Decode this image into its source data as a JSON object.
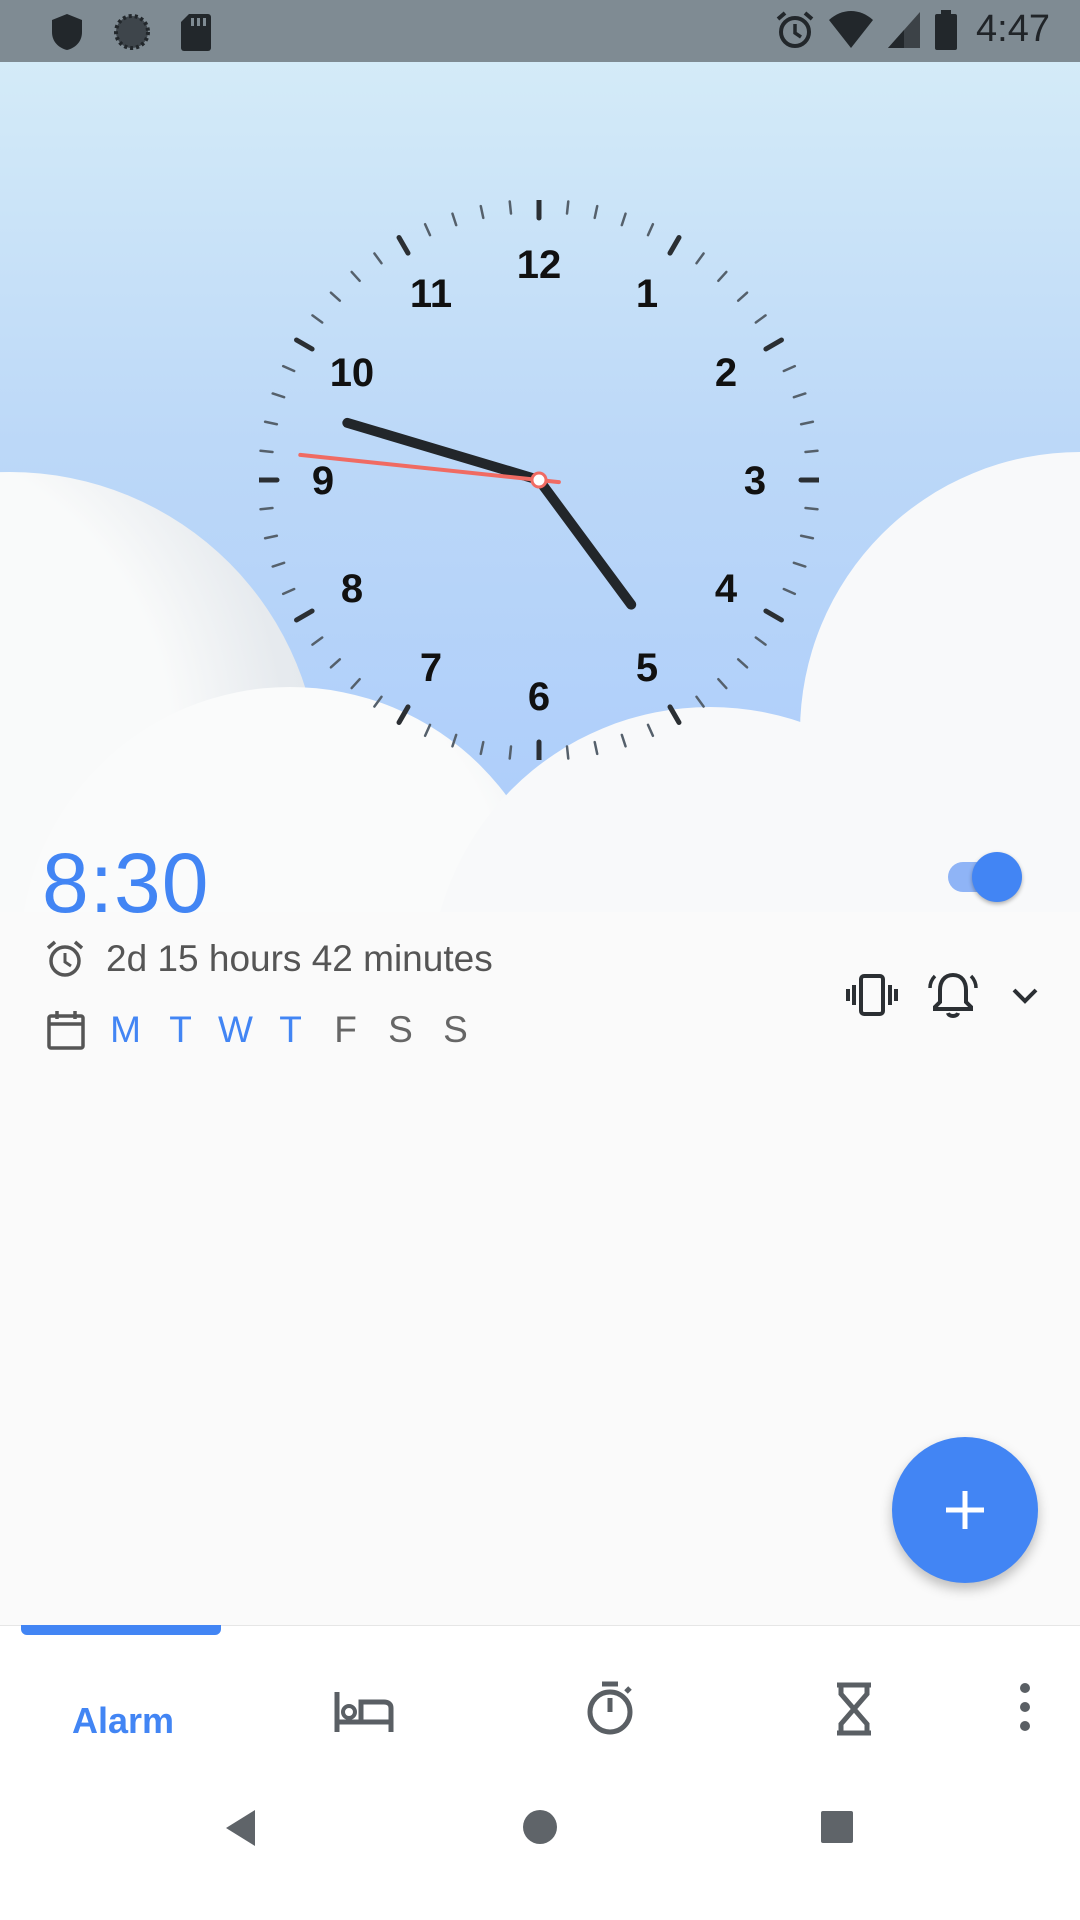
{
  "status_bar": {
    "time": "4:47",
    "left_icons": [
      "shield-icon",
      "sync-icon",
      "sd-card-icon"
    ],
    "right_icons": [
      "alarm-icon",
      "wifi-icon",
      "signal-icon",
      "battery-icon"
    ]
  },
  "clock": {
    "numbers": [
      "12",
      "1",
      "2",
      "3",
      "4",
      "5",
      "6",
      "7",
      "8",
      "9",
      "10",
      "11"
    ],
    "hour": 4,
    "minute": 47,
    "second": 46
  },
  "alarm": {
    "time": "8:30",
    "enabled": true,
    "remaining": "2d 15 hours 42 minutes",
    "days": [
      {
        "label": "M",
        "active": true
      },
      {
        "label": "T",
        "active": true
      },
      {
        "label": "W",
        "active": true
      },
      {
        "label": "T",
        "active": true
      },
      {
        "label": "F",
        "active": false
      },
      {
        "label": "S",
        "active": false
      },
      {
        "label": "S",
        "active": false
      }
    ],
    "icons": [
      "vibrate-icon",
      "bell-icon",
      "chevron-down-icon"
    ]
  },
  "fab": {
    "icon": "add-icon"
  },
  "bottom_nav": {
    "active_label": "Alarm",
    "items": [
      "bedtime-icon",
      "stopwatch-icon",
      "timer-icon",
      "more-icon"
    ]
  },
  "system_nav": [
    "back-icon",
    "home-icon",
    "recents-icon"
  ],
  "colors": {
    "accent": "#4285f4",
    "second_hand": "#f06b63",
    "hand": "#22262a",
    "status_bar": "#7f8b93"
  }
}
